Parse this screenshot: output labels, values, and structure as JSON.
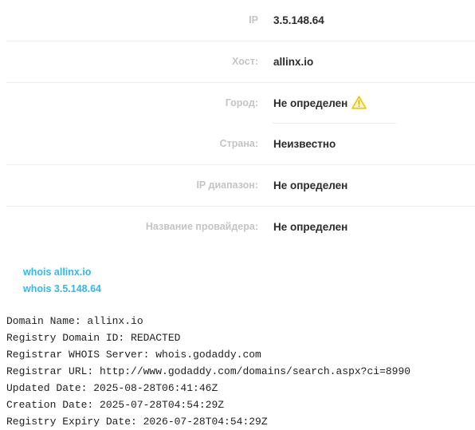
{
  "info": {
    "rows": [
      {
        "label": "IP",
        "value": "3.5.148.64"
      },
      {
        "label": "Хост:",
        "value": "allinx.io"
      },
      {
        "label": "Город:",
        "value": "Не определен",
        "icon": "warning-icon"
      },
      {
        "label": "Страна:",
        "value": "Неизвестно"
      },
      {
        "label": "IP диапазон:",
        "value": "Не определен"
      },
      {
        "label": "Название провайдера:",
        "value": "Не определен"
      }
    ]
  },
  "links": {
    "whois_domain": "whois allinx.io",
    "whois_ip": "whois 3.5.148.64"
  },
  "whois": {
    "lines": [
      "Domain Name: allinx.io",
      "Registry Domain ID: REDACTED",
      "Registrar WHOIS Server: whois.godaddy.com",
      "Registrar URL: http://www.godaddy.com/domains/search.aspx?ci=8990",
      "Updated Date: 2025-08-28T06:41:46Z",
      "Creation Date: 2025-07-28T04:54:29Z",
      "Registry Expiry Date: 2026-07-28T04:54:29Z"
    ]
  },
  "colors": {
    "label": "#c4c4c4",
    "value": "#2b2b2b",
    "link": "#37b6e8",
    "warning": "#f2c200",
    "divider": "#ececec"
  }
}
